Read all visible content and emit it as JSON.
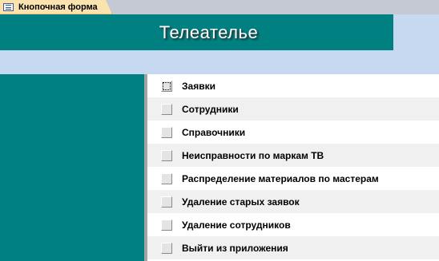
{
  "tab": {
    "label": "Кнопочная форма",
    "icon": "form-icon"
  },
  "header": {
    "title": "Телеателье"
  },
  "menu": {
    "items": [
      {
        "label": "Заявки"
      },
      {
        "label": "Сотрудники"
      },
      {
        "label": "Справочники"
      },
      {
        "label": "Неисправности по маркам ТВ"
      },
      {
        "label": "Распределение материалов по мастерам"
      },
      {
        "label": "Удаление старых заявок"
      },
      {
        "label": "Удаление сотрудников"
      },
      {
        "label": "Выйти из приложения"
      }
    ],
    "focused_index": 0
  },
  "colors": {
    "accent_teal": "#008080",
    "header_band": "#c6d9f0",
    "tab_background": "#fbe3b0"
  }
}
